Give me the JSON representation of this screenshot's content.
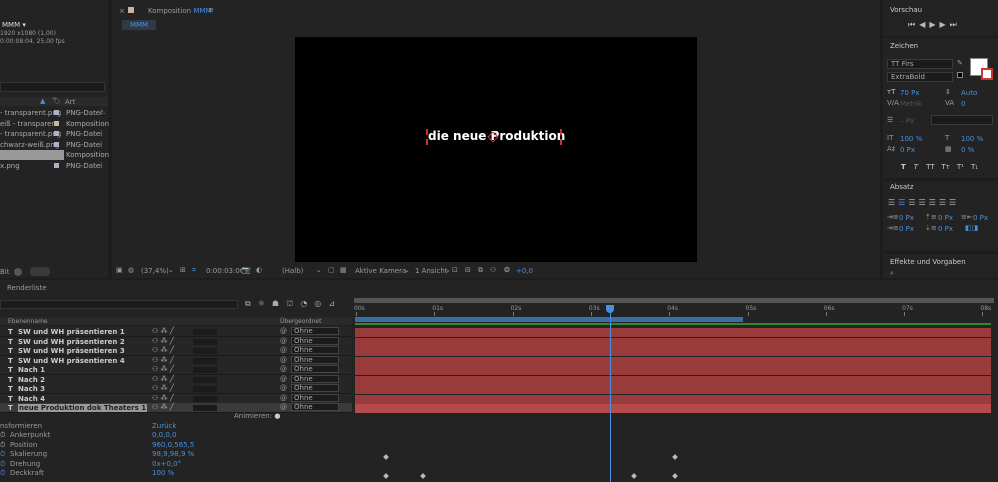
{
  "project": {
    "comp_name": "MMM ▾",
    "comp_res": "1920 x1080 (1,00)",
    "comp_dur": "0:00:08:04, 25,00 fps",
    "col_type": "Art",
    "files": [
      {
        "name": "- transparent.png",
        "type": "PNG-Datei",
        "color": "#b0b0c8"
      },
      {
        "name": "eiß - transparent",
        "type": "Komposition",
        "color": "#c8b89a"
      },
      {
        "name": "- transparent.png",
        "type": "PNG-Datei",
        "color": "#b0b0c8"
      },
      {
        "name": "chwarz-weiß.png",
        "type": "PNG-Datei",
        "color": "#b0b0c8"
      },
      {
        "name": "",
        "type": "Komposition",
        "color": "#c8b89a"
      },
      {
        "name": "x.png",
        "type": "PNG-Datei",
        "color": "#b0b0c8"
      }
    ],
    "bpc": "Bit"
  },
  "comp_panel": {
    "title": "Komposition",
    "title_name": "MMM",
    "tab": "MMM",
    "text": "die neue Produktion",
    "zoom": "(37,4%)",
    "timecode": "0:00:03:06",
    "quality": "(Halb)",
    "camera": "Aktive Kamera",
    "views": "1 Ansicht",
    "exposure": "+0,0"
  },
  "preview": {
    "title": "Vorschau"
  },
  "character": {
    "title": "Zeichen",
    "font": "TT Firs",
    "style": "ExtraBold",
    "size": "70 Px",
    "leading": "Auto",
    "kerning": "Metrik",
    "tracking": "0",
    "stroke": "– Px",
    "vscale": "100 %",
    "hscale": "100 %",
    "baseline": "0 Px",
    "tsume": "0 %",
    "styles": [
      "T",
      "T",
      "TT",
      "Tт",
      "T¹",
      "T₁"
    ]
  },
  "paragraph": {
    "title": "Absatz",
    "indent_left": "0 Px",
    "indent_before": "0 Px",
    "indent_right": "0 Px",
    "first_line": "0 Px",
    "after": "0 Px"
  },
  "effects": {
    "title": "Effekte und Vorgaben"
  },
  "render": {
    "title": "Renderliste"
  },
  "timeline": {
    "col_source": "Ebenenname",
    "col_parent": "Übergeordnet",
    "layers": [
      "SW und WH präsentieren 1",
      "SW und WH präsentieren 2",
      "SW und WH präsentieren 3",
      "SW und WH präsentieren 4",
      "Nach 1",
      "Nach 2",
      "Nach 3",
      "Nach 4",
      "neue Produktion dok Theaters 1"
    ],
    "parent": "Ohne",
    "animate": "Animieren:",
    "transform": "nsformieren",
    "reset": "Zurück",
    "props": [
      {
        "name": "Ankerpunkt",
        "value": "0,0,0,0"
      },
      {
        "name": "Position",
        "value": "960,0,565,5"
      },
      {
        "name": "Skalierung",
        "value": "98,9,98,9 %"
      },
      {
        "name": "Drehung",
        "value": "0x+0,0°"
      },
      {
        "name": "Deckkraft",
        "value": "100 %"
      }
    ],
    "ruler": [
      "00s",
      "01s",
      "02s",
      "03s",
      "04s",
      "05s",
      "06s",
      "07s",
      "08s"
    ],
    "playhead_s": 3.24
  }
}
